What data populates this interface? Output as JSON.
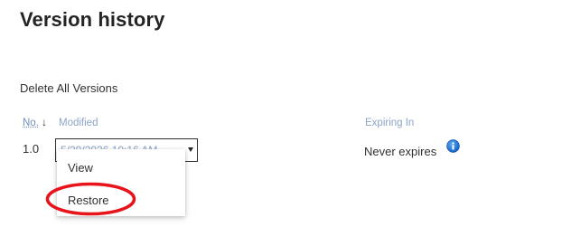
{
  "page": {
    "title": "Version history",
    "delete_all_label": "Delete All Versions"
  },
  "table": {
    "columns": {
      "no": "No.",
      "modified": "Modified",
      "expiring": "Expiring In"
    },
    "sort_indicator": "↓",
    "rows": [
      {
        "version": "1.0",
        "modified": "5/29/2026 10:16 AM",
        "expiring": "Never expires",
        "info_icon": "info-icon"
      }
    ]
  },
  "context_menu": {
    "items": [
      "View",
      "Restore"
    ]
  },
  "colors": {
    "accent": "#0078d4",
    "highlight": "#e8141b"
  }
}
